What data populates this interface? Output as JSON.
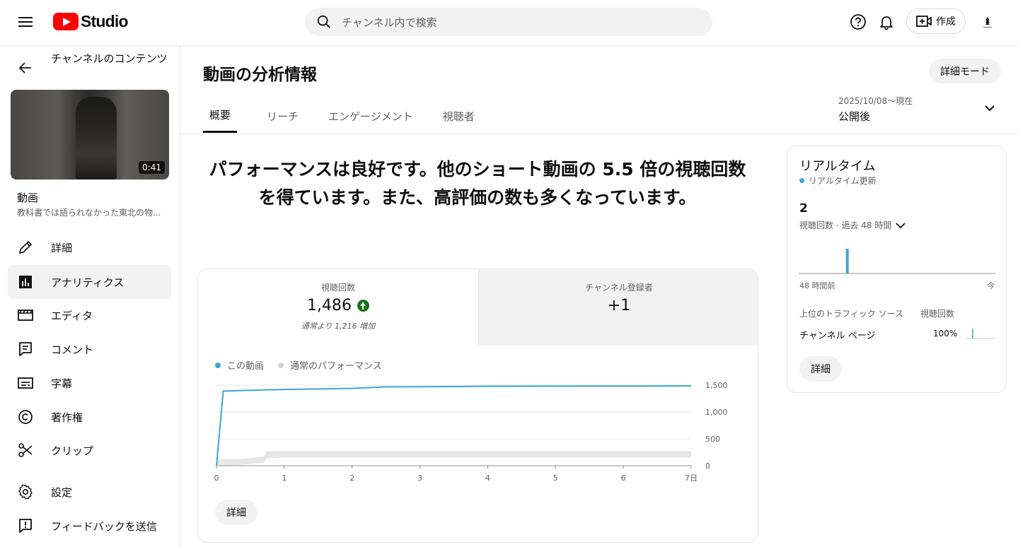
{
  "header": {
    "logo_text": "Studio",
    "search_placeholder": "チャンネル内で検索",
    "create_label": "作成"
  },
  "sidebar": {
    "title": "チャンネルのコンテンツ",
    "video": {
      "duration": "0:41",
      "label": "動画",
      "title": "教科書では語られなかった東北の物..."
    },
    "items": [
      {
        "label": "詳細",
        "icon": "pencil-icon"
      },
      {
        "label": "アナリティクス",
        "icon": "analytics-icon",
        "active": true
      },
      {
        "label": "エディタ",
        "icon": "film-icon"
      },
      {
        "label": "コメント",
        "icon": "comment-icon"
      },
      {
        "label": "字幕",
        "icon": "subtitles-icon"
      },
      {
        "label": "著作権",
        "icon": "copyright-icon"
      },
      {
        "label": "クリップ",
        "icon": "scissors-icon"
      },
      {
        "label": "設定",
        "icon": "gear-icon"
      },
      {
        "label": "フィードバックを送信",
        "icon": "feedback-icon"
      }
    ]
  },
  "main": {
    "title": "動画の分析情報",
    "advanced_label": "詳細モード",
    "tabs": [
      "概要",
      "リーチ",
      "エンゲージメント",
      "視聴者"
    ],
    "active_tab": 0,
    "date_range": {
      "dates": "2025/10/08〜現在",
      "label": "公開後"
    },
    "headline": "パフォーマンスは良好です。他のショート動画の 5.5 倍の視聴回数を得ています。また、高評価の数も多くなっています。",
    "metrics": [
      {
        "label": "視聴回数",
        "value": "1,486",
        "note": "通常より 1,216 増加"
      },
      {
        "label": "チャンネル登録者",
        "value": "+1"
      }
    ],
    "legend": [
      "この動画",
      "通常のパフォーマンス"
    ],
    "detail_label": "詳細"
  },
  "chart_data": {
    "type": "line",
    "x_ticks": [
      "0",
      "1",
      "2",
      "3",
      "4",
      "5",
      "6",
      "7日"
    ],
    "y_ticks": [
      "0",
      "500",
      "1,000",
      "1,500"
    ],
    "ylim": [
      0,
      1500
    ],
    "xlim": [
      0,
      7
    ],
    "series": [
      {
        "name": "この動画",
        "color": "#3ea6d2",
        "points": [
          [
            0,
            0
          ],
          [
            0.1,
            1390
          ],
          [
            0.5,
            1405
          ],
          [
            1,
            1420
          ],
          [
            1.5,
            1430
          ],
          [
            2,
            1440
          ],
          [
            2.5,
            1468
          ],
          [
            3,
            1470
          ],
          [
            3.5,
            1474
          ],
          [
            4,
            1480
          ],
          [
            5,
            1482
          ],
          [
            6,
            1484
          ],
          [
            7,
            1486
          ]
        ]
      },
      {
        "name": "通常のパフォーマンス",
        "color": "#d9d9d9",
        "kind": "band",
        "upper": [
          [
            0,
            120
          ],
          [
            0.4,
            130
          ],
          [
            0.7,
            170
          ],
          [
            0.75,
            270
          ],
          [
            1,
            275
          ],
          [
            2,
            275
          ],
          [
            3,
            275
          ],
          [
            4,
            275
          ],
          [
            5,
            275
          ],
          [
            6,
            275
          ],
          [
            7,
            275
          ]
        ],
        "lower": [
          [
            0,
            0
          ],
          [
            0.4,
            20
          ],
          [
            0.7,
            60
          ],
          [
            0.75,
            140
          ],
          [
            1,
            150
          ],
          [
            2,
            150
          ],
          [
            3,
            150
          ],
          [
            4,
            150
          ],
          [
            5,
            150
          ],
          [
            6,
            150
          ],
          [
            7,
            150
          ]
        ]
      }
    ]
  },
  "realtime": {
    "title": "リアルタイム",
    "subtitle": "リアルタイム更新",
    "count": "2",
    "period": "視聴回数 · 過去 48 時間",
    "axis_left": "48 時間前",
    "axis_right": "今",
    "col1": "上位のトラフィック ソース",
    "col2": "視聴回数",
    "source": "チャンネル ページ",
    "source_pct": "100%",
    "bar_hour_fraction": 0.24,
    "detail_label": "詳細"
  },
  "colors": {
    "accent": "#3ea6d2",
    "brand_red": "#ff0000",
    "up_green": "#107516"
  }
}
